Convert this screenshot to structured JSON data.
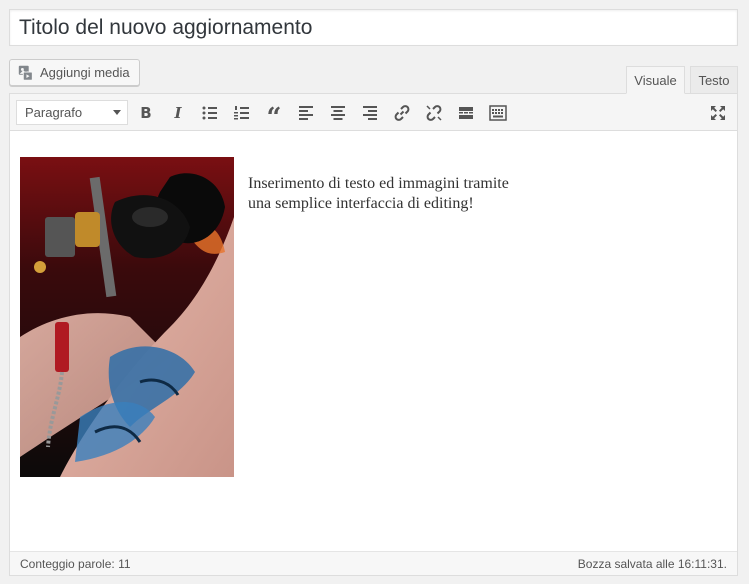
{
  "title": {
    "value": "Titolo del nuovo aggiornamento"
  },
  "toolbar_top": {
    "add_media_label": "Aggiungi media",
    "add_media_icon": "add-media-icon",
    "tabs": [
      {
        "label": "Visuale",
        "active": true
      },
      {
        "label": "Testo",
        "active": false
      }
    ]
  },
  "editor_toolbar": {
    "format_value": "Paragrafo",
    "bold_glyph": "B",
    "italic_glyph": "I",
    "quote_glyph": "“",
    "icons": [
      "bold-icon",
      "italic-icon",
      "bullet-list-icon",
      "numbered-list-icon",
      "blockquote-icon",
      "align-left-icon",
      "align-center-icon",
      "align-right-icon",
      "link-icon",
      "unlink-icon",
      "read-more-icon",
      "toolbar-toggle-icon",
      "fullscreen-icon"
    ]
  },
  "content": {
    "line1": "Inserimento di testo ed immagini tramite",
    "line2": "una semplice interfaccia di editing!",
    "image": "tattoo-photo"
  },
  "status": {
    "word_count": "Conteggio parole: 11",
    "saved": "Bozza salvata alle 16:11:31."
  },
  "colors": {
    "background": "#f1f1f1",
    "border": "#dddddd",
    "toolbar": "#f5f5f5",
    "icon": "#555555"
  }
}
